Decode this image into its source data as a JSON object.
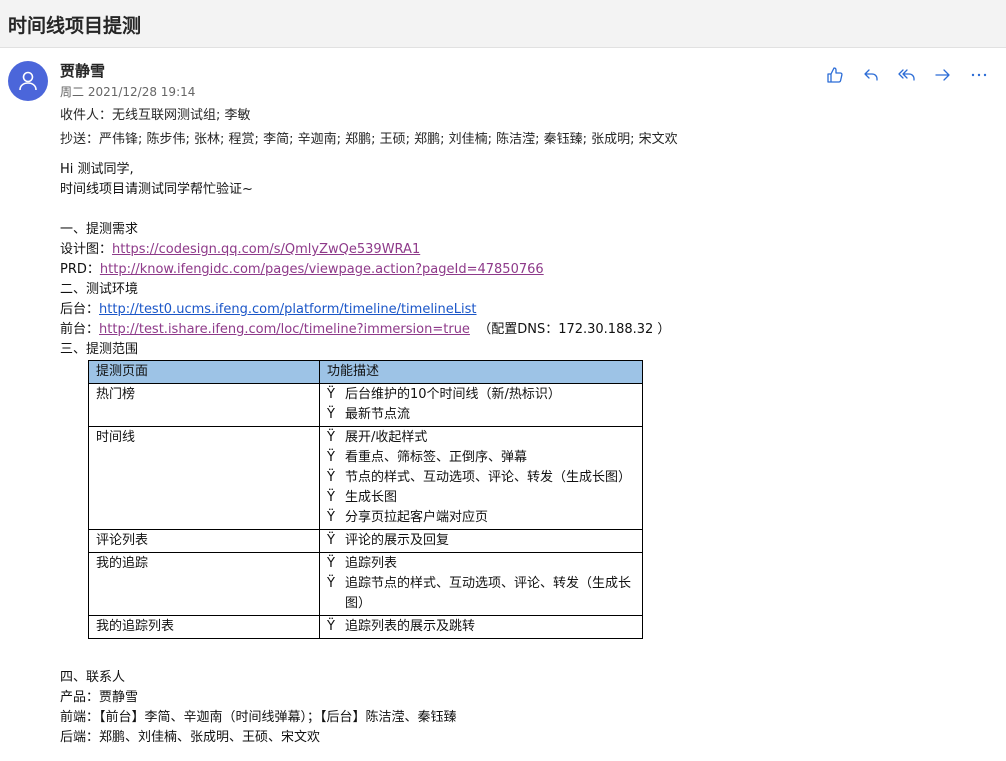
{
  "subject": "时间线项目提测",
  "sender": {
    "name": "贾静雪",
    "date": "周二 2021/12/28 19:14"
  },
  "to": {
    "label": "收件人：",
    "value": "无线互联网测试组; 李敏"
  },
  "cc": {
    "label": "抄送：",
    "value": "严伟锋; 陈步伟; 张林; 程赏; 李简; 辛迦南; 郑鹏; 王硕; 郑鹏; 刘佳楠; 陈洁滢; 秦钰臻; 张成明; 宋文欢"
  },
  "actions": [
    "like-icon",
    "reply-icon",
    "reply-all-icon",
    "forward-icon",
    "more-icon"
  ],
  "body": {
    "greeting": "Hi 测试同学,",
    "intro": "时间线项目请测试同学帮忙验证~",
    "sec1": "一、提测需求",
    "design_label": "设计图：",
    "design_link": "https://codesign.qq.com/s/QmlyZwQe539WRA1",
    "prd_label": "PRD：",
    "prd_link": "http://know.ifengidc.com/pages/viewpage.action?pageId=47850766",
    "sec2": "二、测试环境",
    "backend_label": "后台：",
    "backend_link": "http://test0.ucms.ifeng.com/platform/timeline/timelineList",
    "frontend_label": "前台：",
    "frontend_link": "http://test.ishare.ifeng.com/loc/timeline?immersion=true",
    "dns_note": "（配置DNS：172.30.188.32 ）",
    "sec3": "三、提测范围",
    "sec4": "四、联系人",
    "contact_product": "产品：贾静雪",
    "contact_front": "前端：【前台】李简、辛迦南（时间线弹幕）；【后台】陈洁滢、秦钰臻",
    "contact_back": "后端：郑鹏、刘佳楠、张成明、王硕、宋文欢"
  },
  "table": {
    "headers": [
      "提测页面",
      "功能描述"
    ],
    "bullet": "Ÿ",
    "rows": [
      {
        "page": "热门榜",
        "items": [
          "后台维护的10个时间线（新/热标识）",
          "最新节点流"
        ]
      },
      {
        "page": "时间线",
        "items": [
          "展开/收起样式",
          "看重点、筛标签、正倒序、弹幕",
          "节点的样式、互动选项、评论、转发（生成长图）",
          "生成长图",
          "分享页拉起客户端对应页"
        ]
      },
      {
        "page": "评论列表",
        "items": [
          "评论的展示及回复"
        ]
      },
      {
        "page": "我的追踪",
        "items": [
          "追踪列表",
          "追踪节点的样式、互动选项、评论、转发（生成长图）"
        ]
      },
      {
        "page": "我的追踪列表",
        "items": [
          "追踪列表的展示及跳转"
        ]
      }
    ]
  }
}
